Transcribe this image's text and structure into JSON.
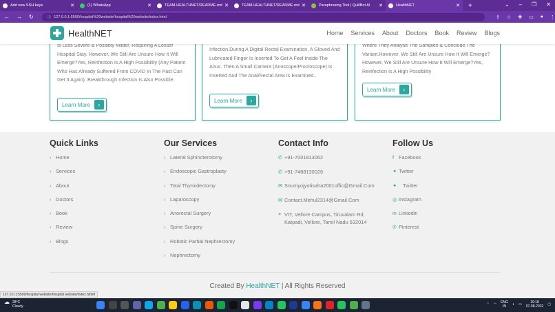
{
  "browser": {
    "tabs": [
      {
        "title": "Add new SSH keys",
        "active": false
      },
      {
        "title": "(1) WhatsApp",
        "active": false
      },
      {
        "title": "TEAM-HEALTHNET/README.md",
        "active": false
      },
      {
        "title": "TEAM-HEALTHNET/README.md",
        "active": false
      },
      {
        "title": "Paraphrasing Tool | QuillBot AI",
        "active": false
      },
      {
        "title": "HealthNET",
        "active": true
      }
    ],
    "new_tab": "+",
    "url": "127.0.0.1:5500/hospital%20website/hospital%20website/index.html",
    "status_url": "127.0.0.1:5500/hospital website/hospital website/index.html#"
  },
  "header": {
    "brand": "HealthNET",
    "menu": [
      "Home",
      "Services",
      "About",
      "Doctors",
      "Book",
      "Review",
      "Blogs"
    ]
  },
  "cards": [
    {
      "text": "Is Less Severe & Possibly Milder, Requiring A Lesser Hospital Stay. However, We Still Are Unsure How It Will Emerge?Yes, Reinfection Is A High Possibility (Any Patient Who Has Already Suffered From COVID In The Past Can Get It Again). Breakthrough Infection Is Also Possible.",
      "button": "Learn More"
    },
    {
      "text": "Infection.During A Digital Rectal Examination, A Gloved And Lubricated Finger Is Inserted To Get A Feel Inside The Anus. Then A Small Camera (Anoscope/Proctoscope) Is Inserted And The Anal/Rectal Area Is Examined..",
      "button": "Learn More"
    },
    {
      "text": "Where They Analyse The Samples & Conclude The Variant.However, We Still Are Unsure How It Will Emerge?However, We Still Are Unsure How It Will Emerge?Yes, Reinfection Is A High Possibility",
      "button": "Learn More"
    }
  ],
  "footer": {
    "quick_links": {
      "title": "Quick Links",
      "items": [
        "Home",
        "Services",
        "About",
        "Doctors",
        "Book",
        "Review",
        "Blogs"
      ]
    },
    "services": {
      "title": "Our Services",
      "items": [
        "Lateral Sphincterotomy",
        "Endoscopic Gastroplasty",
        "Total Thyroidectomy",
        "Laparoscopy",
        "Anorectal Surgery",
        "Spine Surgery",
        "Robotic Partial Nephrectomy",
        "Nephrectomy"
      ]
    },
    "contact": {
      "title": "Contact Info",
      "phone1": "+91-7001813062",
      "phone2": "+91-7488130026",
      "email1": "Soumyojyotisaha2001offic@Gmail.Com",
      "email2": "Contact.Mehul2314@Gmail.Com",
      "address": "VIT, Vellore Campus, Tiruvalam Rd, Katpadi, Vellore, Tamil Nadu 632014"
    },
    "follow": {
      "title": "Follow Us",
      "items": [
        "Facebook",
        "Twitter",
        "Twitter",
        "Instagram",
        "Linkedin",
        "Pinterest"
      ]
    },
    "credit_prefix": "Created By",
    "credit_brand": "HealthNET",
    "credit_suffix": "| All Rights Reserved"
  },
  "taskbar": {
    "weather_temp": "28°C",
    "weather_desc": "Cloudy",
    "lang": "ENG",
    "region": "IN",
    "time": "19:18",
    "date": "07-08-2022"
  }
}
